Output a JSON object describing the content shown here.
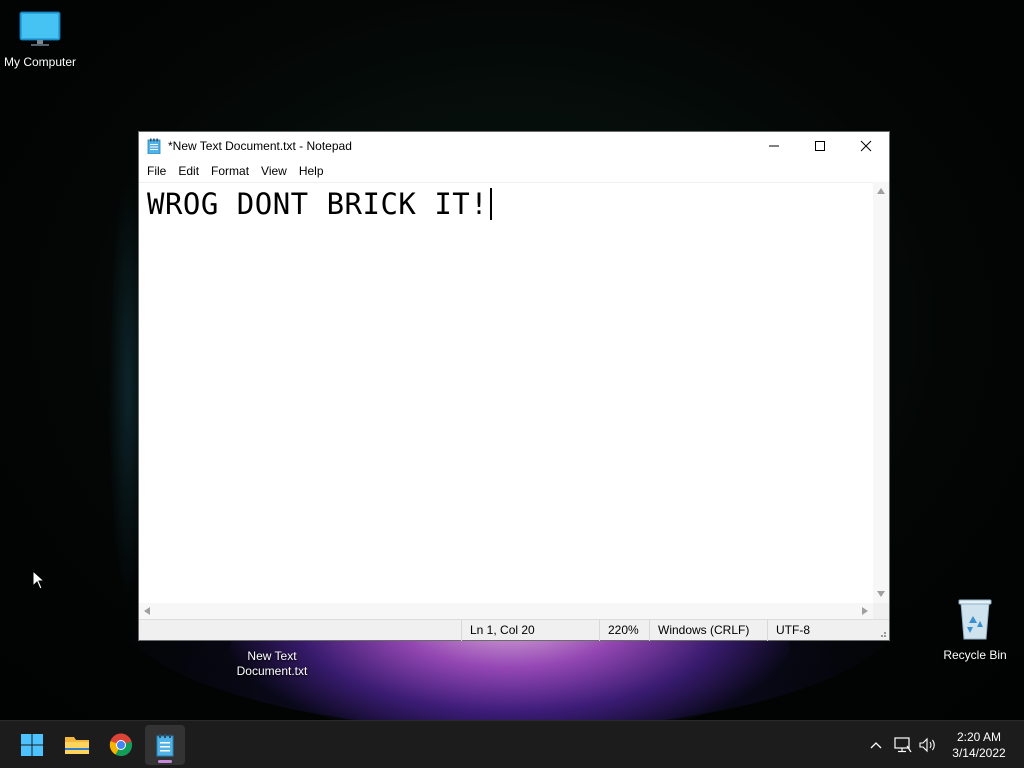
{
  "desktop": {
    "icons": [
      {
        "label": "My Computer",
        "icon": "monitor-icon"
      },
      {
        "label": "New Text Document.txt",
        "icon": "text-file-icon"
      },
      {
        "label": "Recycle Bin",
        "icon": "recycle-bin-icon"
      }
    ]
  },
  "window": {
    "title": "*New Text Document.txt - Notepad",
    "app_icon": "notepad-icon",
    "controls": {
      "minimize": "minimize-icon",
      "maximize": "maximize-icon",
      "close": "close-icon"
    },
    "menu": [
      "File",
      "Edit",
      "Format",
      "View",
      "Help"
    ],
    "content": "WROG DONT BRICK IT!",
    "status": {
      "position": "Ln 1, Col 20",
      "zoom": "220%",
      "line_ending": "Windows (CRLF)",
      "encoding": "UTF-8"
    }
  },
  "taskbar": {
    "apps": [
      {
        "name": "start",
        "icon": "windows-start-icon"
      },
      {
        "name": "file-explorer",
        "icon": "folder-icon"
      },
      {
        "name": "chrome",
        "icon": "chrome-icon"
      },
      {
        "name": "notepad",
        "icon": "notepad-icon",
        "active": true
      }
    ],
    "tray": [
      "chevron-up-icon",
      "network-icon",
      "volume-icon"
    ],
    "time": "2:20 AM",
    "date": "3/14/2022"
  },
  "colors": {
    "taskbar_bg": "#1c1c1c",
    "active_indicator": "#c48ad8",
    "window_bg": "#ffffff"
  }
}
